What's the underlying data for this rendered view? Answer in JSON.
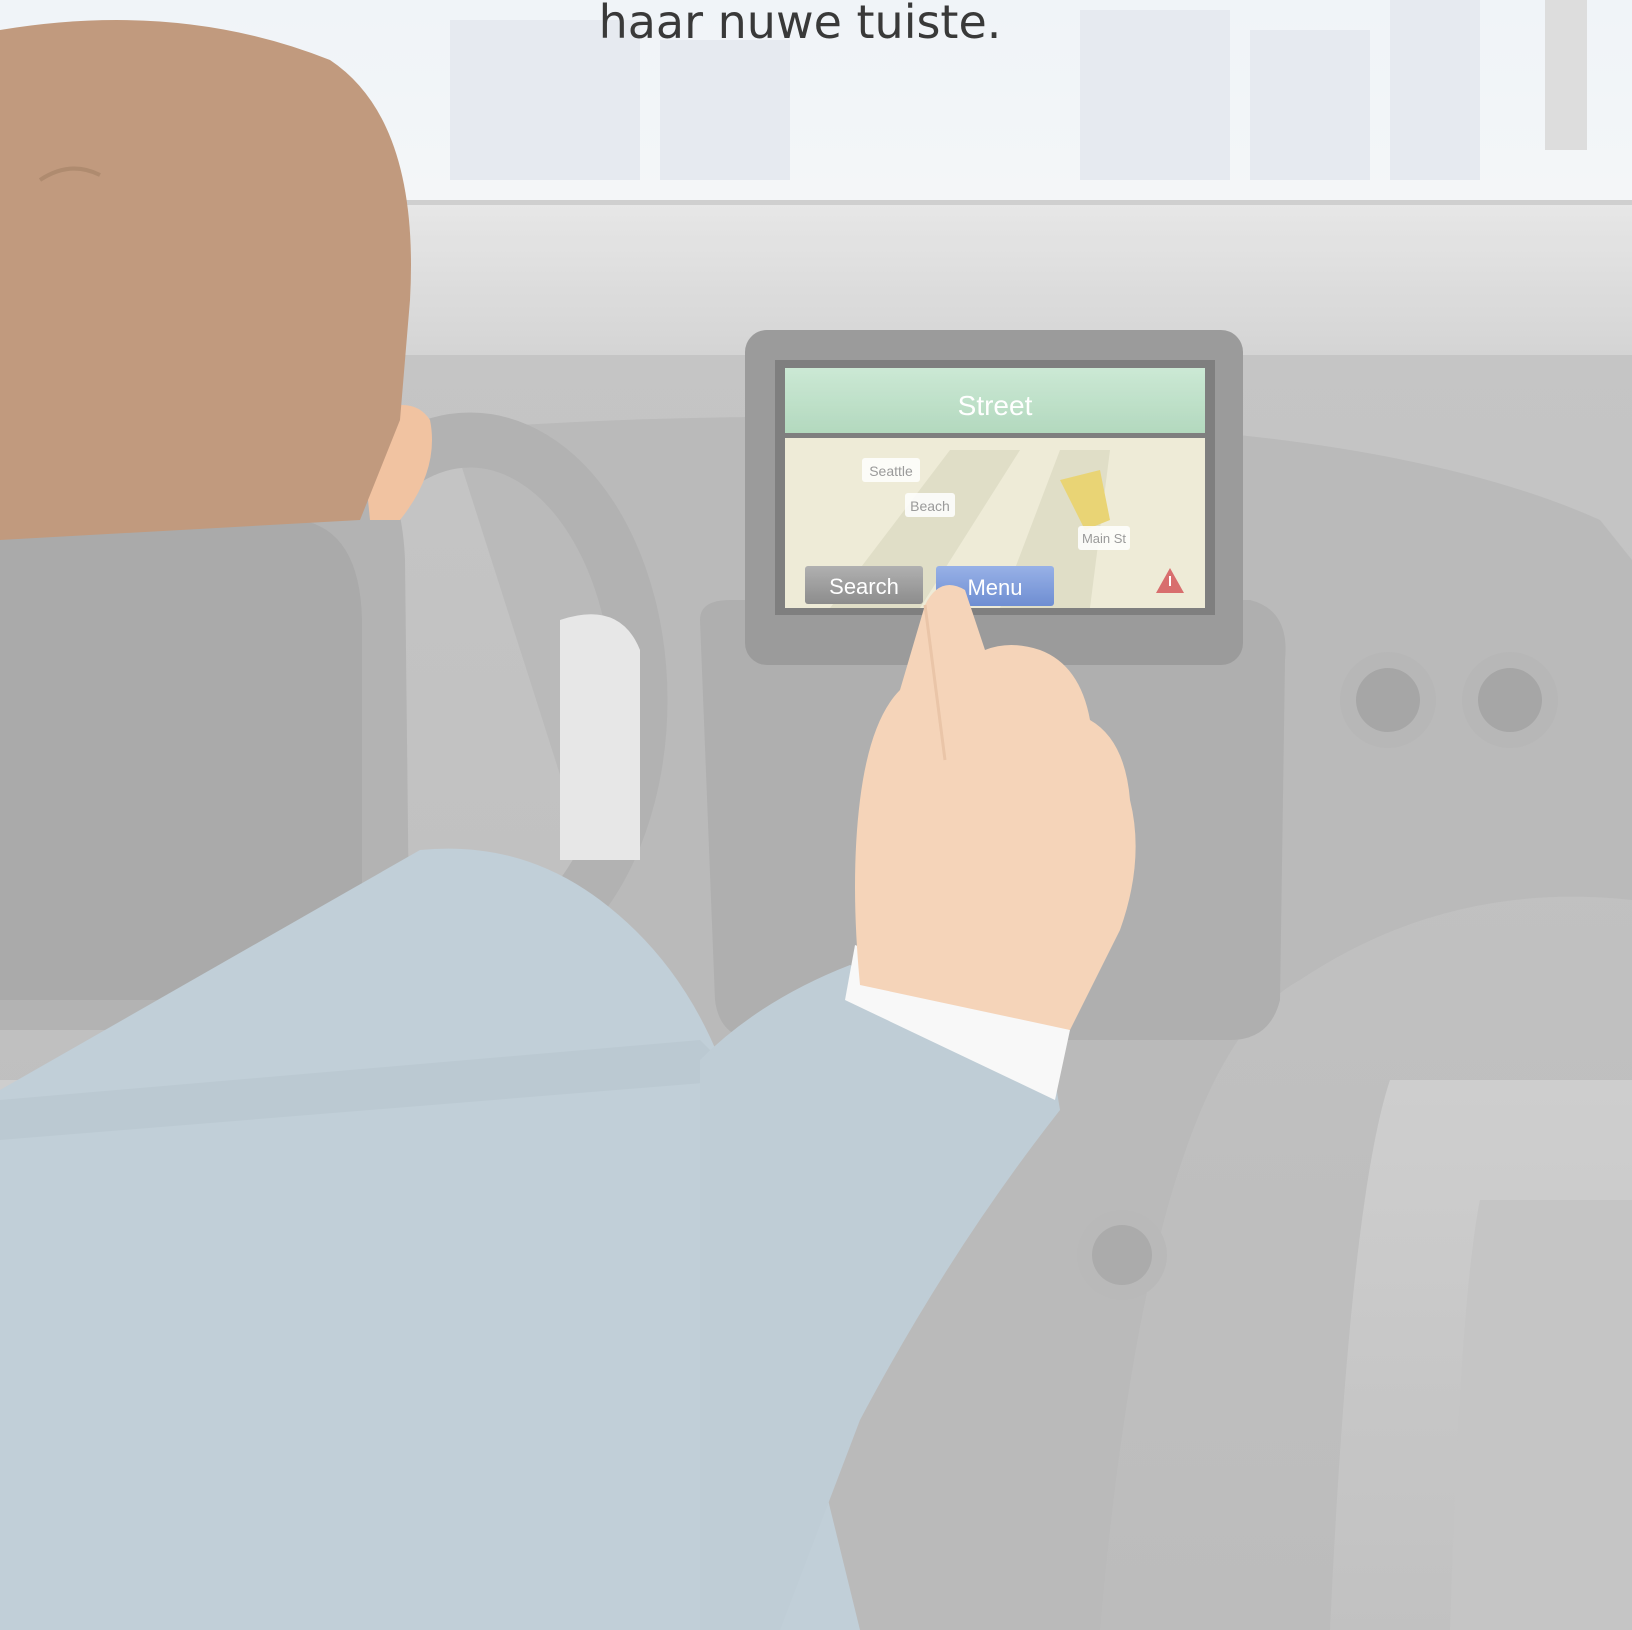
{
  "caption": "haar nuwe tuiste.",
  "navigation": {
    "header": "Street",
    "map_labels": [
      "Seattle",
      "Beach",
      "Main St"
    ],
    "buttons": {
      "search": "Search",
      "menu": "Menu"
    },
    "warning_icon": "warning-triangle-icon"
  },
  "colors": {
    "screen_header": "#b7dcc2",
    "menu_button": "#6c8ed6",
    "search_button": "#8f8f8f",
    "suit": "#b9c9d3",
    "skin": "#f4cfb0",
    "hair": "#b98d6d"
  }
}
